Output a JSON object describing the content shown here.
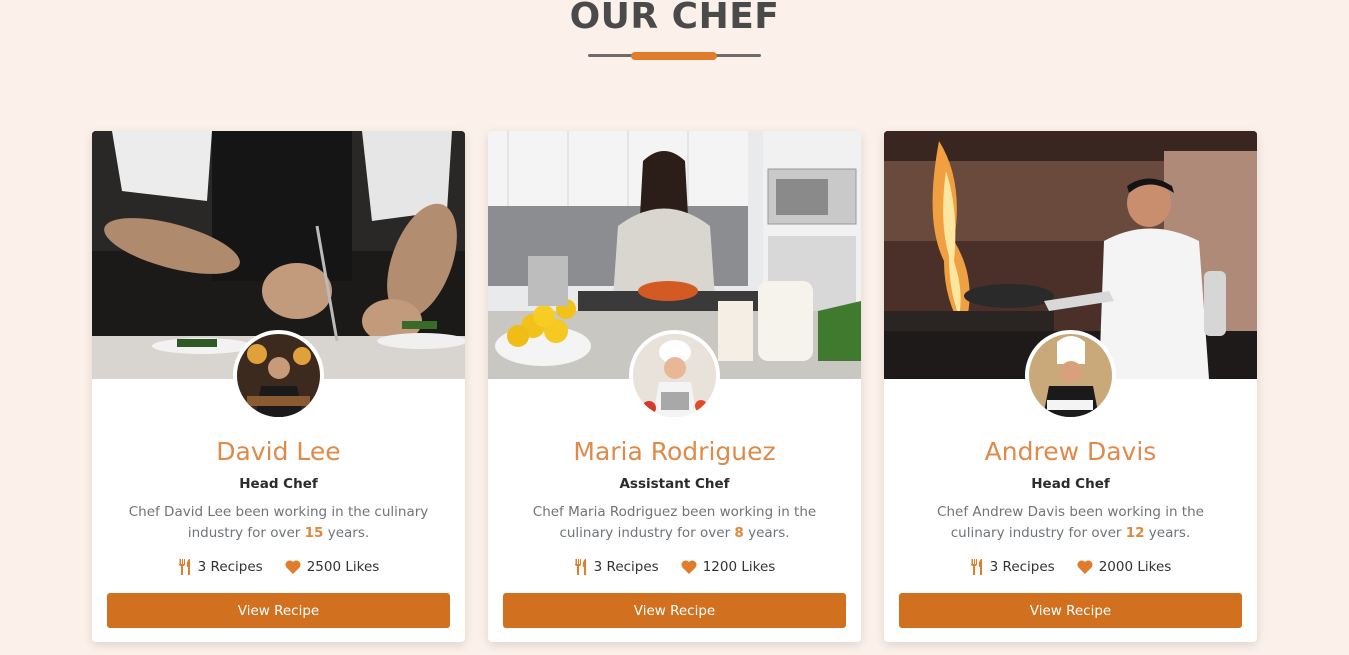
{
  "section": {
    "title": "OUR CHEF"
  },
  "colors": {
    "accent": "#d17120",
    "name": "#e08a4a",
    "background": "#fbf1ea"
  },
  "chefs": [
    {
      "name": "David Lee",
      "role": "Head Chef",
      "bio_before": "Chef David Lee been working in the culinary industry for over ",
      "years": "15",
      "bio_after": " years.",
      "recipes": "3 Recipes",
      "likes": "2500 Likes",
      "button": "View Recipe"
    },
    {
      "name": "Maria Rodriguez",
      "role": "Assistant Chef",
      "bio_before": "Chef Maria Rodriguez been working in the culinary industry for over ",
      "years": "8",
      "bio_after": " years.",
      "recipes": "3 Recipes",
      "likes": "1200 Likes",
      "button": "View Recipe"
    },
    {
      "name": "Andrew Davis",
      "role": "Head Chef",
      "bio_before": "Chef Andrew Davis been working in the culinary industry for over ",
      "years": "12",
      "bio_after": " years.",
      "recipes": "3 Recipes",
      "likes": "2000 Likes",
      "button": "View Recipe"
    }
  ],
  "icons": {
    "recipes": "utensils-icon",
    "likes": "heart-icon"
  }
}
